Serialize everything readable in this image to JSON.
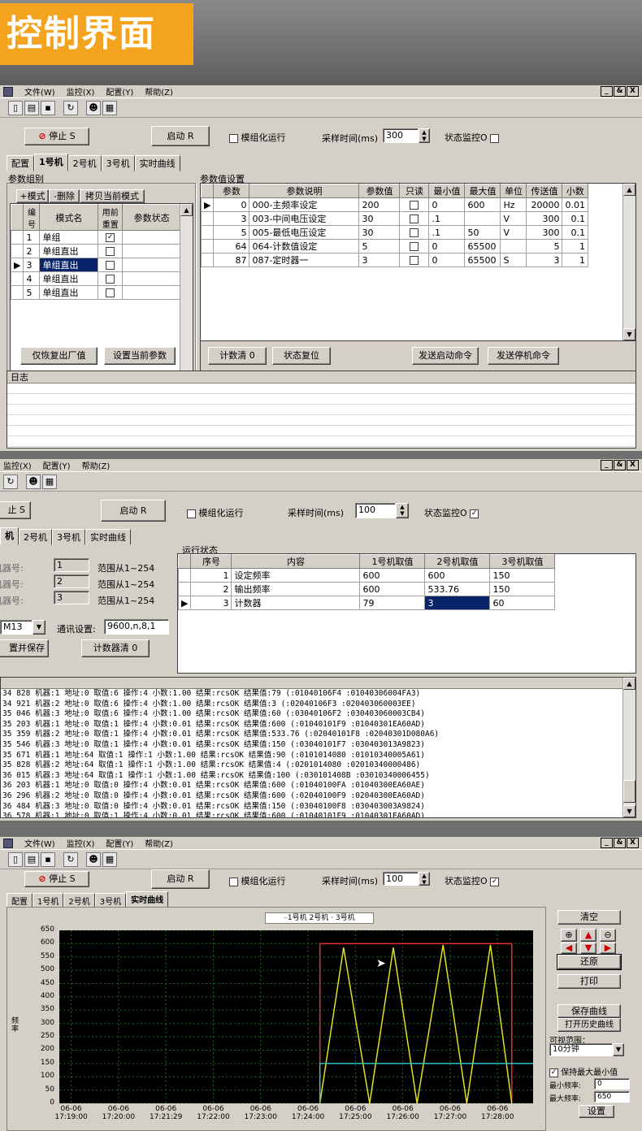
{
  "banner": {
    "title": "控制界面"
  },
  "menu": {
    "items": [
      "文件(W)",
      "监控(X)",
      "配置(Y)",
      "帮助(Z)"
    ],
    "win_controls": [
      "_",
      "&",
      "X"
    ]
  },
  "menu2": {
    "items": [
      "监控(X)",
      "配置(Y)",
      "帮助(Z)"
    ]
  },
  "toolbar": {
    "icons": [
      "new-icon",
      "open-icon",
      "save-icon",
      "refresh-icon",
      "users-icon",
      "print-icon"
    ]
  },
  "controls": {
    "stop_label": "停止 S",
    "stop_label_cut": "止 S",
    "start_label": "启动 R",
    "modular_label": "模组化运行",
    "sample_label": "采样时间(ms)",
    "sample_value_1": "300",
    "sample_value_2": "100",
    "monitor_label": "状态监控O",
    "monitor_checked_1": "",
    "monitor_checked_2": "✓",
    "monitor_checked_3": "✓"
  },
  "tabs1": [
    "配置",
    "1号机",
    "2号机",
    "3号机",
    "实时曲线"
  ],
  "tabs2": [
    "机",
    "2号机",
    "3号机",
    "实时曲线"
  ],
  "tabs3": [
    "配置",
    "1号机",
    "2号机",
    "3号机",
    "实时曲线"
  ],
  "param_group": {
    "title": "参数组别",
    "btn_add": "+模式",
    "btn_del": "-删除",
    "btn_copy": "拷贝当前模式",
    "columns": [
      "编号",
      "模式名",
      "用前重置",
      "参数状态"
    ],
    "rows": [
      {
        "no": "1",
        "name": "单组",
        "reset": "✓"
      },
      {
        "no": "2",
        "name": "单组直出",
        "reset": ""
      },
      {
        "no": "3",
        "name": "单组直出",
        "reset": ""
      },
      {
        "no": "4",
        "name": "单组直出",
        "reset": ""
      },
      {
        "no": "5",
        "name": "单组直出",
        "reset": ""
      }
    ]
  },
  "param_values": {
    "title": "参数值设置",
    "columns": [
      "参数",
      "参数说明",
      "参数值",
      "只读",
      "最小值",
      "最大值",
      "单位",
      "传送值",
      "小数"
    ],
    "rows": [
      {
        "p": "0",
        "desc": "000-主频率设定",
        "val": "200",
        "ro": "",
        "min": "0",
        "max": "600",
        "unit": "Hz",
        "send": "20000",
        "dec": "0.01"
      },
      {
        "p": "3",
        "desc": "003-中间电压设定",
        "val": "30",
        "ro": "",
        "min": ".1",
        "max": "",
        "unit": "V",
        "send": "300",
        "dec": "0.1"
      },
      {
        "p": "5",
        "desc": "005-最低电压设定",
        "val": "30",
        "ro": "",
        "min": ".1",
        "max": "50",
        "unit": "V",
        "send": "300",
        "dec": "0.1"
      },
      {
        "p": "64",
        "desc": "064-计数值设定",
        "val": "5",
        "ro": "",
        "min": "0",
        "max": "65500",
        "unit": "",
        "send": "5",
        "dec": "1"
      },
      {
        "p": "87",
        "desc": "087-定时器一",
        "val": "3",
        "ro": "",
        "min": "0",
        "max": "65500",
        "unit": "S",
        "send": "3",
        "dec": "1"
      }
    ]
  },
  "bottom_buttons": {
    "restore": "仅恢复出厂值",
    "set_params": "设置当前参数",
    "count_clear": "计数清 0",
    "status_reset": "状态复位",
    "send_start": "发送启动命令",
    "send_stop": "发送停机命令"
  },
  "log_title": "日志",
  "machines": {
    "labels": [
      "机器号:",
      "机器号:",
      "机器号:"
    ],
    "values": [
      "1",
      "2",
      "3"
    ],
    "range": "范围从1~254",
    "port": "M13",
    "comm_label": "通讯设置:",
    "comm_value": "9600,n,8,1",
    "save_btn": "置并保存",
    "count_btn": "计数器清 0"
  },
  "run_status": {
    "title": "运行状态",
    "columns": [
      "序号",
      "内容",
      "1号机取值",
      "2号机取值",
      "3号机取值"
    ],
    "rows": [
      {
        "no": "1",
        "name": "设定频率",
        "m1": "600",
        "m2": "600",
        "m3": "150"
      },
      {
        "no": "2",
        "name": "输出频率",
        "m1": "600",
        "m2": "533.76",
        "m3": "150"
      },
      {
        "no": "3",
        "name": "计数器",
        "m1": "79",
        "m2": "3",
        "m3": "60"
      }
    ]
  },
  "log_lines": [
    "34 828 机器:1 地址:0 取值:6 操作:4 小数:1.00 结果:rcsOK 结果值:79 (:01040106F4 :01040306004FA3)",
    "34 921 机器:2 地址:0 取值:6 操作:4 小数:1.00 结果:rcsOK 结果值:3 (:02040106F3 :020403060003EE)",
    "35 046 机器:3 地址:0 取值:6 操作:4 小数:1.00 结果:rcsOK 结果值:60 (:03040106F2 :030403060003CB4)",
    "35 203 机器:1 地址:0 取值:1 操作:4 小数:0.01 结果:rcsOK 结果值:600 (:01040101F9 :01040301EA60AD)",
    "35 359 机器:2 地址:0 取值:1 操作:4 小数:0.01 结果:rcsOK 结果值:533.76 (:02040101F8 :02040301D080A6)",
    "35 546 机器:3 地址:0 取值:1 操作:4 小数:0.01 结果:rcsOK 结果值:150 (:03040101F7 :030403013A9823)",
    "35 671 机器:1 地址:64 取值:1 操作:1 小数:1.00 结果:rcsOK 结果值:90 (:0101014080 :01010340005A61)",
    "35 828 机器:2 地址:64 取值:1 操作:1 小数:1.00 结果:rcsOK 结果值:4 (:0201014080 :02010340000486)",
    "36 015 机器:3 地址:64 取值:1 操作:1 小数:1.00 结果:rcsOK 结果值:100 (:030101408B :03010340006455)",
    "36 203 机器:1 地址:0 取值:0 操作:4 小数:0.01 结果:rcsOK 结果值:600 (:01040100FA :01040300EA60AE)",
    "36 296 机器:2 地址:0 取值:0 操作:4 小数:0.01 结果:rcsOK 结果值:600 (:02040100F9 :02040300EA60AD)",
    "36 484 机器:3 地址:0 取值:0 操作:4 小数:0.01 结果:rcsOK 结果值:150 (:03040100F8 :030403003A9824)",
    "36 578 机器:1 地址:0 取值:1 操作:4 小数:0.01 结果:rcsOK 结果值:600 (:01040101F9 :01040301EA60AD)"
  ],
  "chart_panel": {
    "clear": "清空",
    "restore": "还原",
    "print": "打印",
    "save_curve": "保存曲线",
    "open_history": "打开历史曲线",
    "view_range_label": "可视范围：",
    "view_range_value": "10分钟",
    "keep_minmax": "保持最大最小值",
    "min_label": "最小频率:",
    "min_value": "0",
    "max_label": "最大频率:",
    "max_value": "650",
    "set": "设置",
    "legend": [
      "1号机",
      "2号机",
      "3号机"
    ]
  },
  "chart_data": {
    "type": "line",
    "ylabel": "频率",
    "ylim": [
      0,
      650
    ],
    "yticks": [
      0,
      50,
      100,
      150,
      200,
      250,
      300,
      350,
      400,
      450,
      500,
      550,
      600,
      650
    ],
    "xticks": [
      "06-06 17:19:00",
      "06-06 17:20:00",
      "06-06 17:21:29",
      "06-06 17:22:00",
      "06-06 17:23:00",
      "06-06 17:24:00",
      "06-06 17:25:00",
      "06-06 17:26:00",
      "06-06 17:27:00",
      "06-06 17:28:00"
    ],
    "xlim_min": [
      0,
      10
    ],
    "grid": true,
    "series": [
      {
        "name": "1号机",
        "color": "#e03030",
        "x": [
          5.5,
          5.5,
          9.55,
          9.55
        ],
        "y": [
          0,
          600,
          600,
          0
        ]
      },
      {
        "name": "2号机",
        "color": "#e0e020",
        "x": [
          5.5,
          6.0,
          6.55,
          7.05,
          7.55,
          8.1,
          8.6,
          9.1,
          9.55
        ],
        "y": [
          0,
          585,
          0,
          585,
          0,
          595,
          0,
          595,
          0
        ]
      },
      {
        "name": "3号机",
        "color": "#30c0c0",
        "x": [
          5.5,
          5.5,
          10,
          10
        ],
        "y": [
          0,
          150,
          150,
          150
        ]
      }
    ],
    "colors": {
      "background": "#000000",
      "grid": "#1f6b1f"
    }
  }
}
